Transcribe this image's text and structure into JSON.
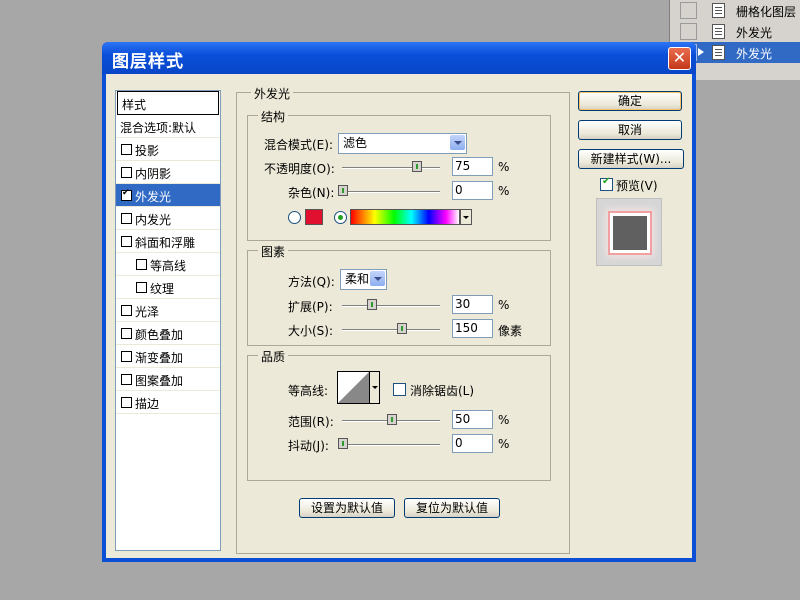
{
  "layers_panel": {
    "items": [
      {
        "label": "栅格化图层",
        "selected": false
      },
      {
        "label": "外发光",
        "selected": false
      },
      {
        "label": "外发光",
        "selected": true
      }
    ]
  },
  "dialog": {
    "title": "图层样式",
    "close_icon": "close-icon",
    "style_list": {
      "header": "样式",
      "blend_options": "混合选项:默认",
      "items": [
        {
          "label": "投影",
          "checked": false
        },
        {
          "label": "内阴影",
          "checked": false
        },
        {
          "label": "外发光",
          "checked": true,
          "selected": true
        },
        {
          "label": "内发光",
          "checked": false
        },
        {
          "label": "斜面和浮雕",
          "checked": false
        },
        {
          "label": "等高线",
          "checked": false
        },
        {
          "label": "纹理",
          "checked": false
        },
        {
          "label": "光泽",
          "checked": false
        },
        {
          "label": "颜色叠加",
          "checked": false
        },
        {
          "label": "渐变叠加",
          "checked": false
        },
        {
          "label": "图案叠加",
          "checked": false
        },
        {
          "label": "描边",
          "checked": false
        }
      ]
    },
    "panel_title": "外发光",
    "structure": {
      "title": "结构",
      "blend_mode_label": "混合模式(E):",
      "blend_mode_value": "滤色",
      "opacity_label": "不透明度(O):",
      "opacity_value": "75",
      "opacity_unit": "%",
      "opacity_level": 0.75,
      "noise_label": "杂色(N):",
      "noise_value": "0",
      "noise_unit": "%",
      "noise_level": 0,
      "color_swatch": "#e0102e"
    },
    "elements": {
      "title": "图素",
      "technique_label": "方法(Q):",
      "technique_value": "柔和",
      "spread_label": "扩展(P):",
      "spread_value": "30",
      "spread_unit": "%",
      "spread_level": 0.3,
      "size_label": "大小(S):",
      "size_value": "150",
      "size_unit": "像素",
      "size_level": 0.6
    },
    "quality": {
      "title": "品质",
      "contour_label": "等高线:",
      "anti_alias_label": "消除锯齿(L)",
      "range_label": "范围(R):",
      "range_value": "50",
      "range_unit": "%",
      "range_level": 0.5,
      "jitter_label": "抖动(J):",
      "jitter_value": "0",
      "jitter_unit": "%",
      "jitter_level": 0
    },
    "buttons": {
      "make_default": "设置为默认值",
      "reset_default": "复位为默认值",
      "ok": "确定",
      "cancel": "取消",
      "new_style": "新建样式(W)...",
      "preview": "预览(V)"
    }
  }
}
